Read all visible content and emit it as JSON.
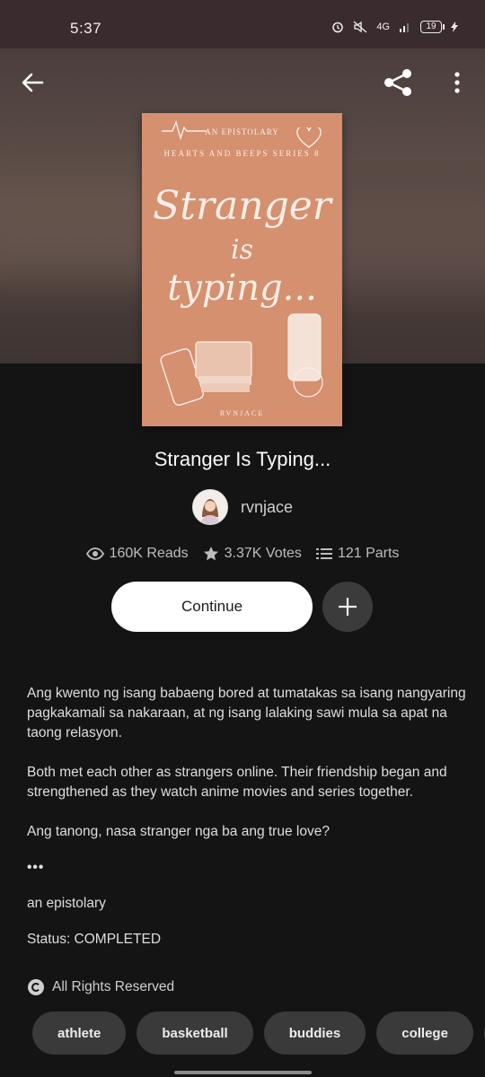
{
  "status_bar": {
    "time": "5:37",
    "network": "4G",
    "battery": "19"
  },
  "cover": {
    "subtitle": "AN EPISTOLARY",
    "series": "HEARTS AND BEEPS SERIES 8",
    "title_line1": "Stranger",
    "title_line2": "is",
    "title_line3": "typing...",
    "author": "RVNJACE"
  },
  "book": {
    "title": "Stranger Is Typing...",
    "author": "rvnjace",
    "reads": "160K Reads",
    "votes": "3.37K Votes",
    "parts": "121 Parts"
  },
  "actions": {
    "continue_label": "Continue"
  },
  "description": {
    "p1": "Ang kwento ng isang babaeng bored at tumatakas sa isang nangyaring pagkakamali sa nakaraan, at ng isang lalaking sawi mula sa apat na taong relasyon.",
    "p2": "Both met each other as strangers online. Their friendship began and strengthened as they watch anime movies and series together.",
    "p3": "Ang tanong, nasa stranger nga ba ang true love?",
    "p4": "•••",
    "p5": "an epistolary",
    "p6": "Status: COMPLETED"
  },
  "rights": "All Rights Reserved",
  "tags": [
    "athlete",
    "basketball",
    "buddies",
    "college"
  ],
  "colors": {
    "background": "#141414",
    "cover": "#d4906f",
    "statusbar": "#3a2b2f"
  }
}
